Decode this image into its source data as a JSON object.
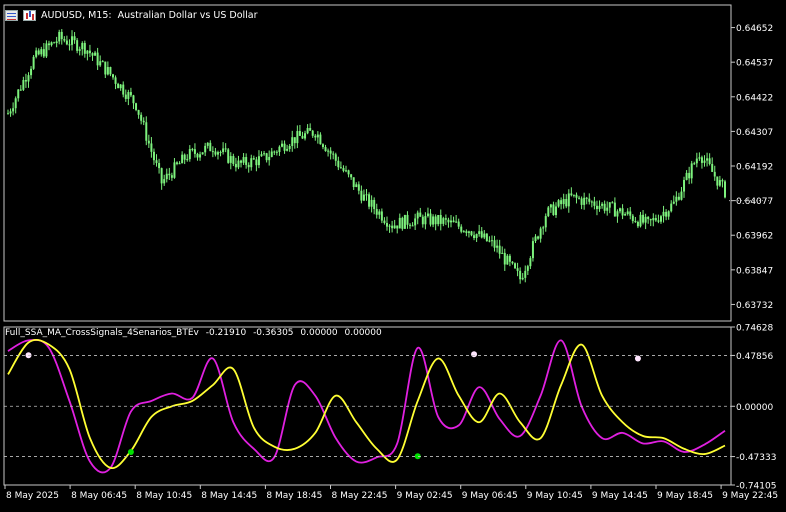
{
  "header": {
    "symbol_timeframe": "AUDUSD, M15:",
    "description": "Australian Dollar vs US Dollar"
  },
  "indicator": {
    "name": "Full_SSA_MA_CrossSignals_4Senarios_BTEv",
    "values": [
      "-0.21910",
      "-0.36305",
      "0.00000",
      "0.00000"
    ]
  },
  "price_axis": {
    "labels": [
      "0.64652",
      "0.64537",
      "0.64422",
      "0.64307",
      "0.64192",
      "0.64077",
      "0.63962",
      "0.63847",
      "0.63732"
    ],
    "current_price_level": 0.64077
  },
  "indicator_axis": {
    "labels": [
      "0.74628",
      "0.47856",
      "0.00000",
      "-0.47333",
      "-0.74105"
    ],
    "levels": [
      0.47856,
      0.0,
      -0.47333
    ]
  },
  "time_axis": {
    "labels": [
      "8 May 2025",
      "8 May 06:45",
      "8 May 10:45",
      "8 May 14:45",
      "8 May 18:45",
      "8 May 22:45",
      "9 May 02:45",
      "9 May 06:45",
      "9 May 10:45",
      "9 May 14:45",
      "9 May 18:45",
      "9 May 22:45"
    ]
  },
  "colors": {
    "candle": "#7df27d",
    "ssa_line": "#e020e0",
    "ma_line": "#ffff33",
    "signal_buy": "#00e000",
    "signal_sell": "#ffe6ff",
    "grid": "#c0c0c0"
  },
  "chart_data": [
    {
      "type": "line",
      "title": "AUDUSD, M15: Australian Dollar vs US Dollar",
      "xlabel": "",
      "ylabel": "",
      "ylim": [
        0.63677,
        0.64727
      ],
      "x": [
        0,
        10,
        20,
        30,
        40,
        50,
        60,
        70,
        80,
        90,
        100,
        110,
        120,
        130,
        140,
        150,
        160,
        170,
        180,
        190,
        200,
        210,
        220,
        230,
        240,
        250,
        260,
        270,
        280
      ],
      "series": [
        {
          "name": "",
          "values": [
            0.64367,
            0.64547,
            0.64617,
            0.64587,
            0.64497,
            0.64397,
            0.64137,
            0.64227,
            0.64257,
            0.64197,
            0.64217,
            0.64277,
            0.64307,
            0.64187,
            0.64077,
            0.63997,
            0.64017,
            0.64007,
            0.63982,
            0.63927,
            0.63817,
            0.64032,
            0.64087,
            0.64067,
            0.64037,
            0.63997,
            0.64067,
            0.64237,
            0.64107
          ]
        }
      ]
    },
    {
      "type": "line",
      "title": "Full_SSA_MA_CrossSignals_4Senarios_BTEv",
      "xlabel": "",
      "ylabel": "",
      "ylim": [
        -0.74105,
        0.74628
      ],
      "x": [
        0,
        8,
        16,
        24,
        32,
        40,
        48,
        56,
        64,
        72,
        80,
        88,
        96,
        104,
        112,
        120,
        128,
        136,
        144,
        152,
        160,
        168,
        176,
        184,
        192,
        200,
        208,
        216,
        224,
        232,
        240,
        248,
        256,
        264,
        272,
        280
      ],
      "series": [
        {
          "name": "",
          "values": [
            0.52,
            0.62,
            0.55,
            0.05,
            -0.52,
            -0.58,
            -0.05,
            0.05,
            0.12,
            0.08,
            0.45,
            -0.15,
            -0.4,
            -0.48,
            0.2,
            0.1,
            -0.3,
            -0.52,
            -0.48,
            -0.35,
            0.55,
            -0.1,
            -0.18,
            0.18,
            -0.12,
            -0.28,
            0.1,
            0.62,
            0.0,
            -0.3,
            -0.25,
            -0.35,
            -0.33,
            -0.43,
            -0.36,
            -0.23
          ]
        },
        {
          "name": "",
          "values": [
            0.3,
            0.6,
            0.58,
            0.35,
            -0.3,
            -0.58,
            -0.42,
            -0.1,
            0.0,
            0.05,
            0.2,
            0.35,
            -0.2,
            -0.38,
            -0.4,
            -0.25,
            0.1,
            -0.15,
            -0.4,
            -0.5,
            0.05,
            0.45,
            0.1,
            -0.15,
            0.12,
            -0.15,
            -0.3,
            0.2,
            0.58,
            0.1,
            -0.15,
            -0.28,
            -0.3,
            -0.4,
            -0.45,
            -0.37
          ]
        }
      ],
      "signals": [
        {
          "x": 8,
          "y": 0.48
        },
        {
          "x": 48,
          "y": -0.43
        },
        {
          "x": 160,
          "y": -0.47
        },
        {
          "x": 182,
          "y": 0.49
        },
        {
          "x": 246,
          "y": 0.45
        }
      ]
    }
  ]
}
